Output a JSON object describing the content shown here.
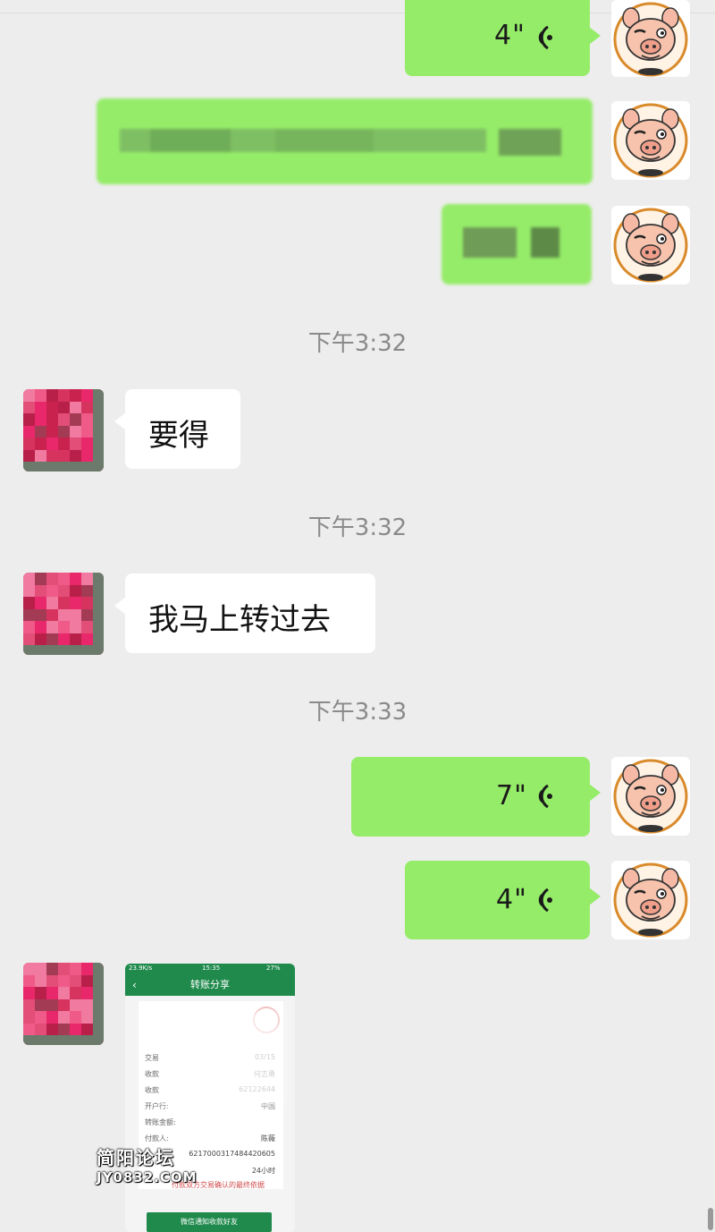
{
  "messages": {
    "voice1": {
      "duration": "4\""
    },
    "timestamp1": "下午3:32",
    "text1": "要得",
    "timestamp2": "下午3:32",
    "text2": "我马上转过去",
    "timestamp3": "下午3:33",
    "voice2": {
      "duration": "7\""
    },
    "voice3": {
      "duration": "4\""
    }
  },
  "avatar_pig": {
    "ring_text": "简阳论坛",
    "site": "WWW.JY0832.COM",
    "icon": "pig-cartoon-icon"
  },
  "screenshot": {
    "status_left": "23.9K/s",
    "status_time": "15:35",
    "status_right": "27%",
    "title": "转账分享",
    "rows": [
      {
        "label": "交易",
        "value": "03/15"
      },
      {
        "label": "收款",
        "value": "何志勇"
      },
      {
        "label": "收款",
        "value": "62122644"
      },
      {
        "label": "开户行:",
        "value": "中国"
      },
      {
        "label": "转账金额:",
        "value": ""
      },
      {
        "label": "付款人:",
        "value": "陈薇"
      },
      {
        "label": "",
        "value": "6217000317484420605"
      },
      {
        "label": "",
        "value": "24小时"
      }
    ],
    "notice": "付款双方交易确认的最终依据",
    "button": "微信通知收款好友"
  },
  "watermark": {
    "line1": "简阳论坛",
    "line2": "JY0832.COM"
  },
  "colors": {
    "bubble_green": "#95ec69",
    "background": "#ededed",
    "bank_green": "#1f8a4c"
  }
}
